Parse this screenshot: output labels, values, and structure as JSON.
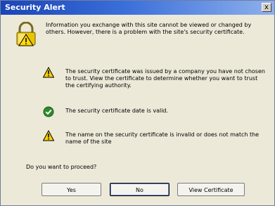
{
  "window": {
    "title": "Security Alert",
    "close_label": "x"
  },
  "intro": {
    "icon": "padlock-warning-icon",
    "text": "Information you exchange with this site cannot be viewed or changed by others. However, there is a problem with the site's security certificate."
  },
  "items": [
    {
      "icon": "warning-icon",
      "text": "The security certificate was issued by a company you have not chosen to trust. View the certificate to determine whether you want to trust the certifying authority."
    },
    {
      "icon": "check-icon",
      "text": "The security certificate date is valid."
    },
    {
      "icon": "warning-icon",
      "text": "The name on the security certificate is invalid or does not match the name of the site"
    }
  ],
  "question": "Do you want to proceed?",
  "buttons": {
    "yes": "Yes",
    "no": "No",
    "view": "View Certificate"
  },
  "colors": {
    "title_bar": "#1b44b8",
    "warning": "#f5d100",
    "check": "#2c8a2c"
  }
}
